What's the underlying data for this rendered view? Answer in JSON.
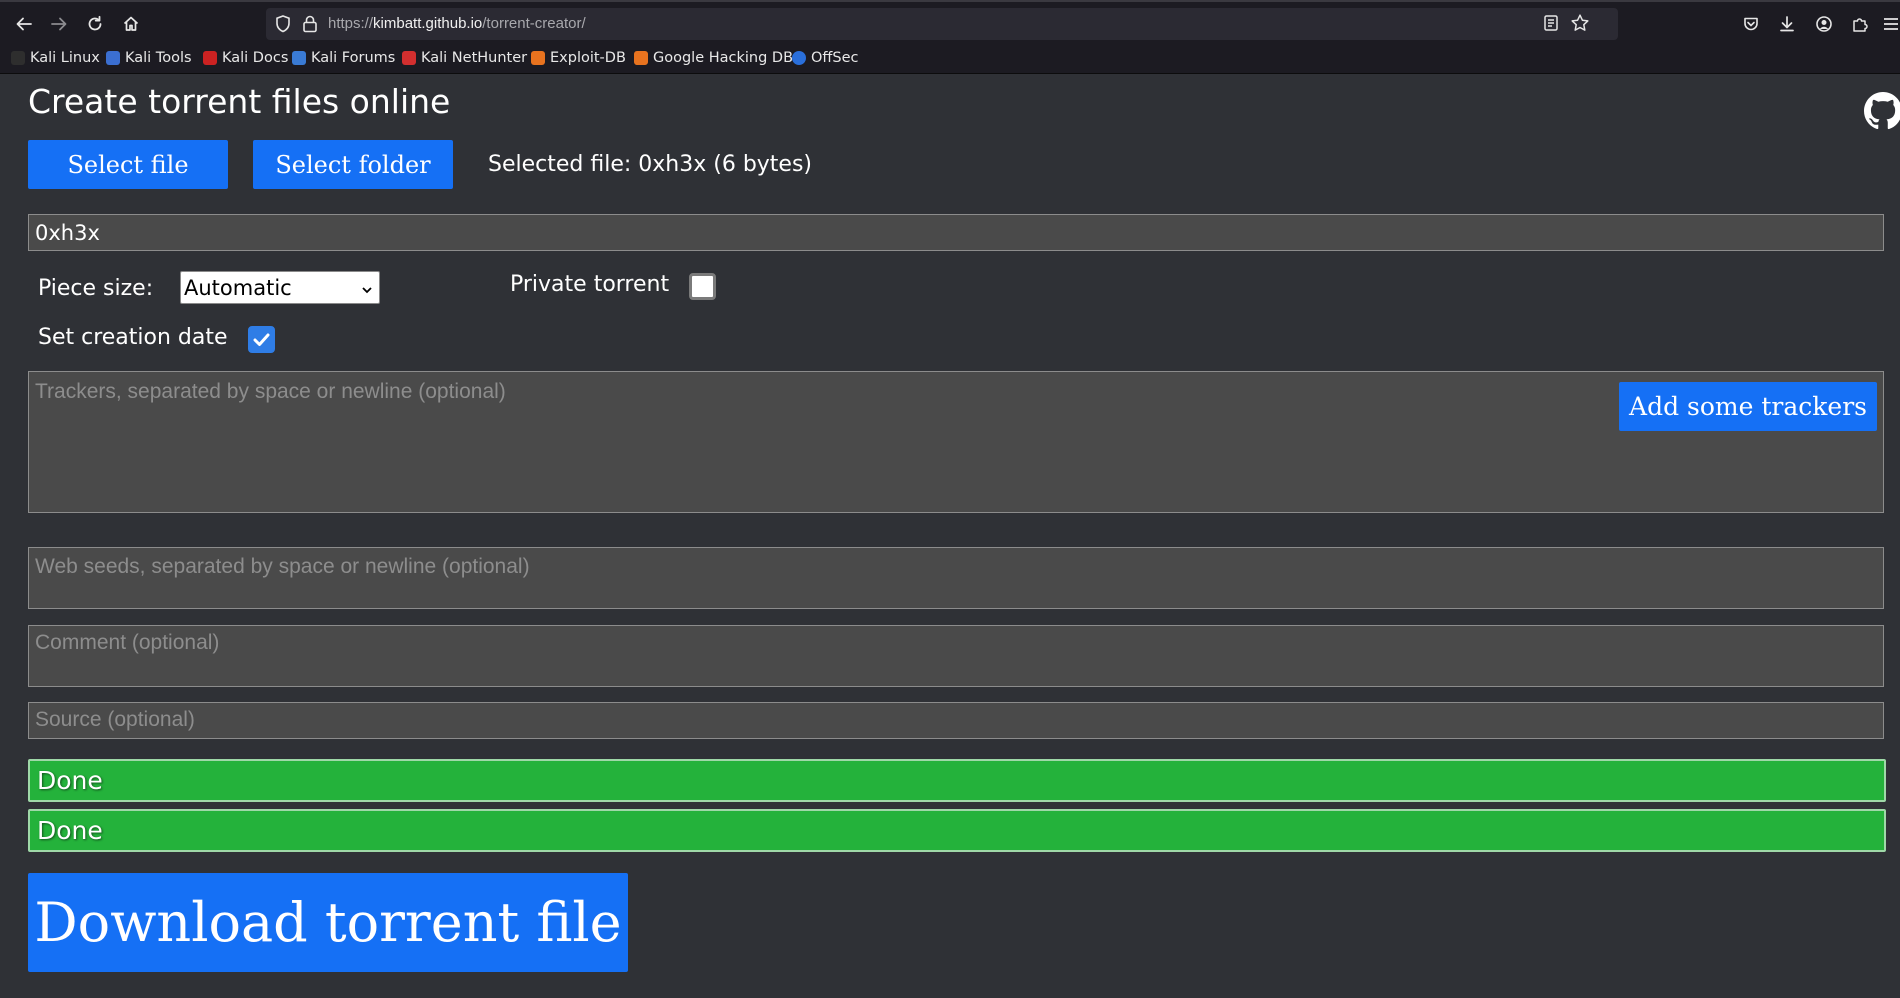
{
  "browser": {
    "url_prefix": "https://",
    "url_host": "kimbatt.github.io",
    "url_path": "/torrent-creator/",
    "bookmarks": [
      {
        "label": "Kali Linux",
        "color": "#2e2e2e"
      },
      {
        "label": "Kali Tools",
        "color": "#3b6fd1"
      },
      {
        "label": "Kali Docs",
        "color": "#cc2222"
      },
      {
        "label": "Kali Forums",
        "color": "#3a7bd5"
      },
      {
        "label": "Kali NetHunter",
        "color": "#d32f2f"
      },
      {
        "label": "Exploit-DB",
        "color": "#e8731f"
      },
      {
        "label": "Google Hacking DB",
        "color": "#e8731f"
      },
      {
        "label": "OffSec",
        "color": "#2a6fdb"
      }
    ]
  },
  "page": {
    "title": "Create torrent files online",
    "select_file_label": "Select file",
    "select_folder_label": "Select folder",
    "selected_file_text": "Selected file: 0xh3x (6 bytes)",
    "name_value": "0xh3x",
    "piece_size_label": "Piece size:",
    "piece_size_value": "Automatic",
    "private_label": "Private torrent",
    "private_checked": false,
    "creation_date_label": "Set creation date",
    "creation_date_checked": true,
    "trackers_placeholder": "Trackers, separated by space or newline (optional)",
    "add_trackers_label": "Add some trackers",
    "webseeds_placeholder": "Web seeds, separated by space or newline (optional)",
    "comment_placeholder": "Comment (optional)",
    "source_placeholder": "Source (optional)",
    "progress": [
      {
        "label": "Done",
        "percent": 100
      },
      {
        "label": "Done",
        "percent": 100
      }
    ],
    "download_label": "Download torrent file"
  },
  "colors": {
    "accent_blue": "#1570f5",
    "done_green": "#24b23b",
    "page_bg": "#2f3136"
  },
  "icons": [
    "back-icon",
    "forward-icon",
    "reload-icon",
    "home-icon",
    "shield-icon",
    "lock-icon",
    "reader-icon",
    "star-icon",
    "pocket-icon",
    "download-icon",
    "account-icon",
    "extensions-icon",
    "menu-icon",
    "github-icon",
    "chevron-down-icon",
    "checkmark-icon"
  ]
}
